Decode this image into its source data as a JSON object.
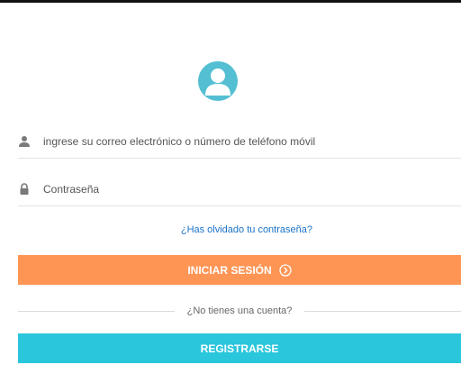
{
  "login_form": {
    "email_placeholder": "ingrese su correo electrónico o número de teléfono móvil",
    "password_placeholder": "Contraseña",
    "forgot_password": "¿Has olvidado tu contraseña?",
    "login_button": "INICIAR SESIÓN",
    "no_account": "¿No tienes una cuenta?",
    "register_button": "REGISTRARSE"
  },
  "icons": {
    "avatar": "user-avatar-icon",
    "email": "user-icon",
    "password": "lock-icon",
    "login_arrow": "chevron-right-circle-icon"
  },
  "colors": {
    "avatar": "#54bfd3",
    "login_button": "#ff9555",
    "register_button": "#29c6dc",
    "link": "#1a73c8"
  }
}
